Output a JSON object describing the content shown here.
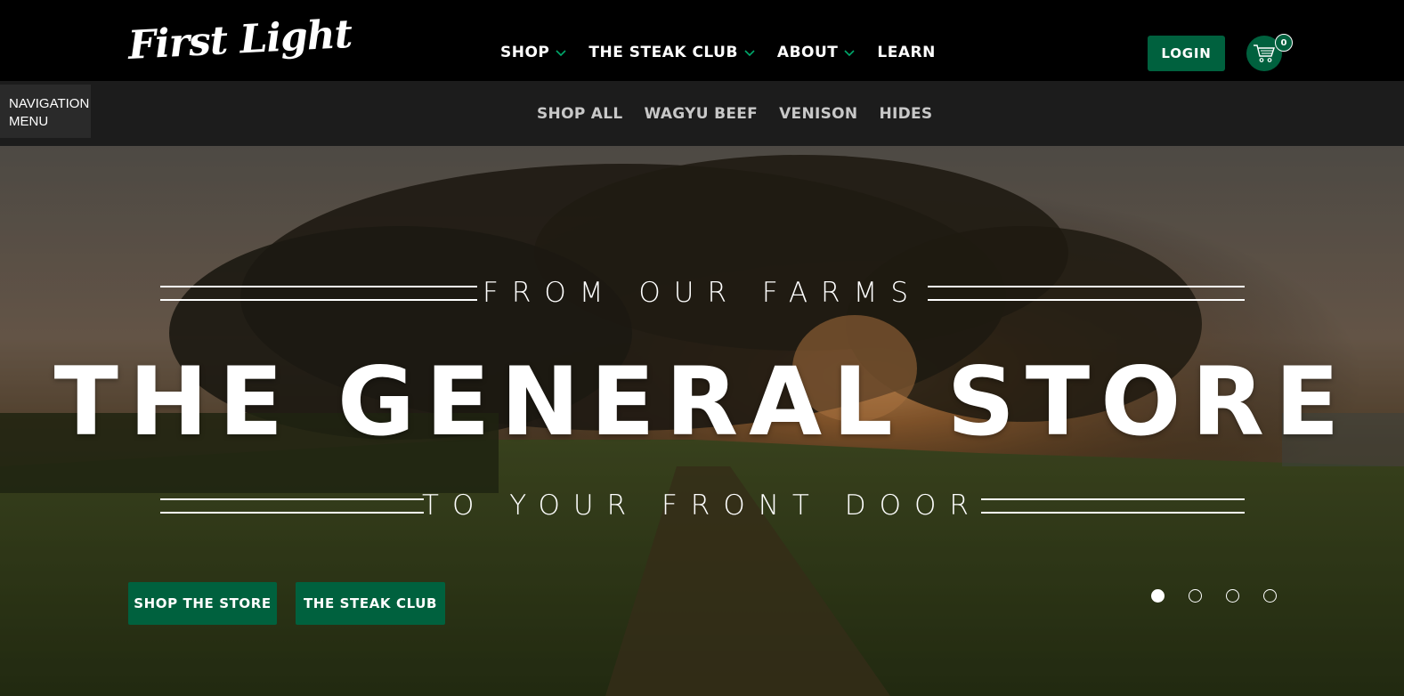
{
  "brand": {
    "logo_text": "First Light"
  },
  "header": {
    "nav": [
      {
        "label": "SHOP",
        "has_dropdown": true
      },
      {
        "label": "THE STEAK CLUB",
        "has_dropdown": true
      },
      {
        "label": "ABOUT",
        "has_dropdown": true
      },
      {
        "label": "LEARN",
        "has_dropdown": false
      }
    ],
    "login_label": "LOGIN",
    "cart_count": "0"
  },
  "subheader": {
    "menu_button_label": "NAVIGATION MENU",
    "items": [
      "SHOP ALL",
      "WAGYU BEEF",
      "VENISON",
      "HIDES"
    ]
  },
  "hero": {
    "eyebrow": "FROM OUR FARMS",
    "headline": "THE GENERAL STORE",
    "tagline": "TO YOUR FRONT DOOR",
    "buttons": [
      "SHOP THE STORE",
      "THE STEAK CLUB"
    ],
    "slides_total": 4,
    "active_slide": 1
  },
  "colors": {
    "brand_green": "#00613e",
    "header_bg": "#000000",
    "subnav_bg": "#1c1c1c"
  }
}
